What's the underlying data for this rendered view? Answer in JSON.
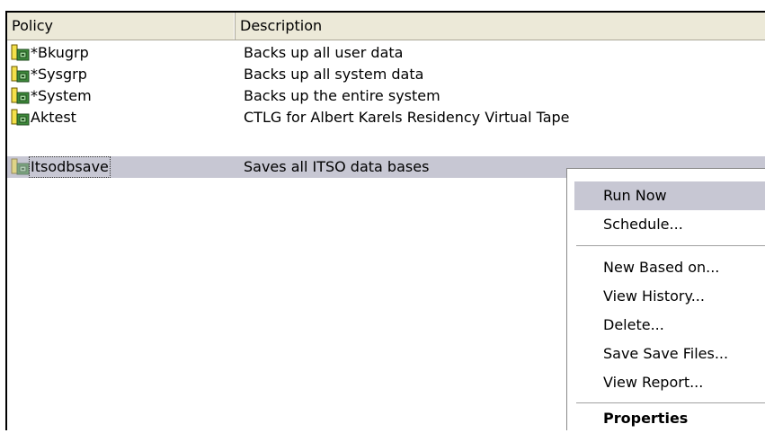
{
  "columns": {
    "policy": "Policy",
    "description": "Description"
  },
  "rows": [
    {
      "name": "*Bkugrp",
      "description": "Backs up all user data",
      "icon": "policy-icon"
    },
    {
      "name": "*Sysgrp",
      "description": "Backs up all system data",
      "icon": "policy-icon"
    },
    {
      "name": "*System",
      "description": "Backs up the entire system",
      "icon": "policy-icon"
    },
    {
      "name": "Aktest",
      "description": "CTLG for Albert Karels Residency Virtual Tape",
      "icon": "policy-icon"
    },
    {
      "name": "Itsodbsave",
      "description": "Saves all ITSO data bases",
      "icon": "policy-icon",
      "selected": true
    }
  ],
  "context_menu": {
    "items": [
      "Run Now",
      "Schedule...",
      "New Based on...",
      "View History...",
      "Delete...",
      "Save Save Files...",
      "View Report...",
      "Properties"
    ],
    "highlighted": "Run Now"
  },
  "colors": {
    "selection": "#c7c7d3",
    "header_bg": "#ece9d8"
  }
}
